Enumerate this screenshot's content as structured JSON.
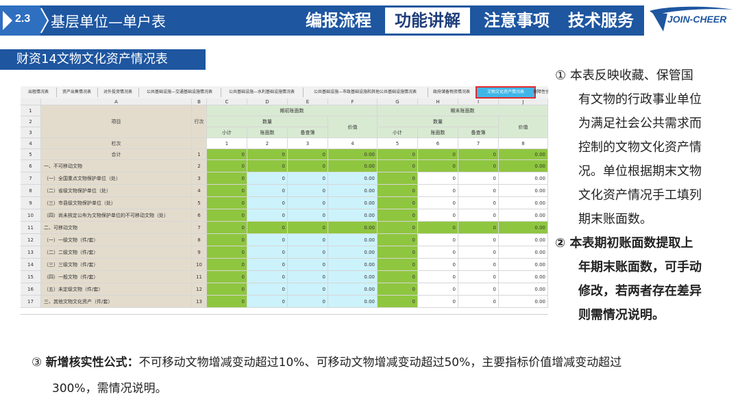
{
  "header": {
    "section_number": "2.3",
    "section_title": "基层单位—单户表",
    "nav": [
      {
        "label": "编报流程",
        "active": false
      },
      {
        "label": "功能讲解",
        "active": true
      },
      {
        "label": "注意事项",
        "active": false
      },
      {
        "label": "技术服务",
        "active": false
      }
    ],
    "logo_text": "JOIN-CHEER",
    "brand_color": "#1e56a0"
  },
  "subtitle": "财资14文物文化资产情况表",
  "sheet": {
    "tabs": [
      {
        "label": "出租情况表",
        "active": false
      },
      {
        "label": "资产出售情况表",
        "active": false
      },
      {
        "label": "对外投资情况表",
        "active": false
      },
      {
        "label": "公共基础设施—交通基础设施情况表",
        "active": false
      },
      {
        "label": "公共基础设施—水利基础设施情况表",
        "active": false
      },
      {
        "label": "公共基础设施—市政基础设施和其他公共基础设施情况表",
        "active": false
      },
      {
        "label": "政府储备物资情况表",
        "active": false
      },
      {
        "label": "文物文化资产情况表",
        "active": true
      },
      {
        "label": "保障性住",
        "active": false
      }
    ],
    "column_letters": [
      "A",
      "B",
      "C",
      "D",
      "E",
      "F",
      "G",
      "H",
      "I",
      "J"
    ],
    "header": {
      "item": "项目",
      "line_no": "行次",
      "group_start": "期初账面数",
      "group_end": "期末账面数",
      "quantity": "数量",
      "value": "价值",
      "subtotal": "小计",
      "registered": "账面数",
      "pending": "备查簿",
      "col_index_label": "栏次",
      "col_numbers": [
        "1",
        "2",
        "3",
        "4",
        "5",
        "6",
        "7",
        "8"
      ]
    },
    "row_numbers": [
      "1",
      "2",
      "3",
      "4",
      "5",
      "6",
      "7",
      "8",
      "9",
      "10",
      "11",
      "12",
      "13",
      "14",
      "15",
      "16",
      "17"
    ],
    "rows": [
      {
        "label": "合计",
        "line": "1",
        "values": [
          "0",
          "0",
          "0",
          "0.00",
          "0",
          "0",
          "0",
          "0.00"
        ],
        "style": "total"
      },
      {
        "label": "一、不可移动文物",
        "line": "2",
        "values": [
          "0",
          "0",
          "0",
          "0.00",
          "0",
          "0",
          "0",
          "0.00"
        ],
        "style": "total"
      },
      {
        "label": "（一）全国重点文物保护单位（处）",
        "line": "3",
        "values": [
          "0",
          "0",
          "0",
          "0.00",
          "0",
          "0",
          "0",
          "0.00"
        ],
        "style": "input"
      },
      {
        "label": "（二）省级文物保护单位（处）",
        "line": "4",
        "values": [
          "0",
          "0",
          "0",
          "0.00",
          "0",
          "0",
          "0",
          "0.00"
        ],
        "style": "input"
      },
      {
        "label": "（三）市县级文物保护单位（处）",
        "line": "5",
        "values": [
          "0",
          "0",
          "0",
          "0.00",
          "0",
          "0",
          "0",
          "0.00"
        ],
        "style": "input"
      },
      {
        "label": "（四）尚未核定公布为文物保护单位的不可移动文物（处）",
        "line": "6",
        "values": [
          "0",
          "0",
          "0",
          "0.00",
          "0",
          "0",
          "0",
          "0.00"
        ],
        "style": "input"
      },
      {
        "label": "二、可移动文物",
        "line": "7",
        "values": [
          "0",
          "0",
          "0",
          "0.00",
          "0",
          "0",
          "0",
          "0.00"
        ],
        "style": "total"
      },
      {
        "label": "（一）一级文物（件/套）",
        "line": "8",
        "values": [
          "0",
          "0",
          "0",
          "0.00",
          "0",
          "0",
          "0",
          "0.00"
        ],
        "style": "input"
      },
      {
        "label": "（二）二级文物（件/套）",
        "line": "9",
        "values": [
          "0",
          "0",
          "0",
          "0.00",
          "0",
          "0",
          "0",
          "0.00"
        ],
        "style": "input"
      },
      {
        "label": "（三）三级文物（件/套）",
        "line": "10",
        "values": [
          "0",
          "0",
          "0",
          "0.00",
          "0",
          "0",
          "0",
          "0.00"
        ],
        "style": "input"
      },
      {
        "label": "（四）一般文物（件/套）",
        "line": "11",
        "values": [
          "0",
          "0",
          "0",
          "0.00",
          "0",
          "0",
          "0",
          "0.00"
        ],
        "style": "input"
      },
      {
        "label": "（五）未定级文物（件/套）",
        "line": "12",
        "values": [
          "0",
          "0",
          "0",
          "0.00",
          "0",
          "0",
          "0",
          "0.00"
        ],
        "style": "input"
      },
      {
        "label": "三、其他文物文化资产（件/套）",
        "line": "13",
        "values": [
          "0",
          "0",
          "0",
          "0.00",
          "0",
          "0",
          "0",
          "0.00"
        ],
        "style": "input"
      }
    ],
    "colors": {
      "green": "#8fc640",
      "light_blue": "#ccf2fb",
      "tan": "#e3dccd",
      "header_gray": "#eeeeee",
      "header_green": "#d9ead3"
    }
  },
  "notes": [
    {
      "text": "① 本表反映收藏、保管国",
      "bold": false
    },
    {
      "text": "有文物的行政事业单位",
      "bold": false
    },
    {
      "text": "为满足社会公共需求而",
      "bold": false
    },
    {
      "text": "控制的文物文化资产情",
      "bold": false
    },
    {
      "text": "况。单位根据期末文物",
      "bold": false
    },
    {
      "text": "文化资产情况手工填列",
      "bold": false
    },
    {
      "text": "期末账面数。",
      "bold": false
    },
    {
      "text": "② 本表期初账面数提取上",
      "bold": true
    },
    {
      "text": "年期末账面数，可手动",
      "bold": true
    },
    {
      "text": "修改，若两者存在差异",
      "bold": true
    },
    {
      "text": "则需情况说明。",
      "bold": true
    }
  ],
  "bottom": {
    "prefix": "③ ",
    "label": "新增核实性公式：",
    "line1_rest": "不可移动文物增减变动超过10%、可移动文物增减变动超过50%，主要指标价值增减变动超过",
    "line2": "300%，需情况说明。"
  }
}
